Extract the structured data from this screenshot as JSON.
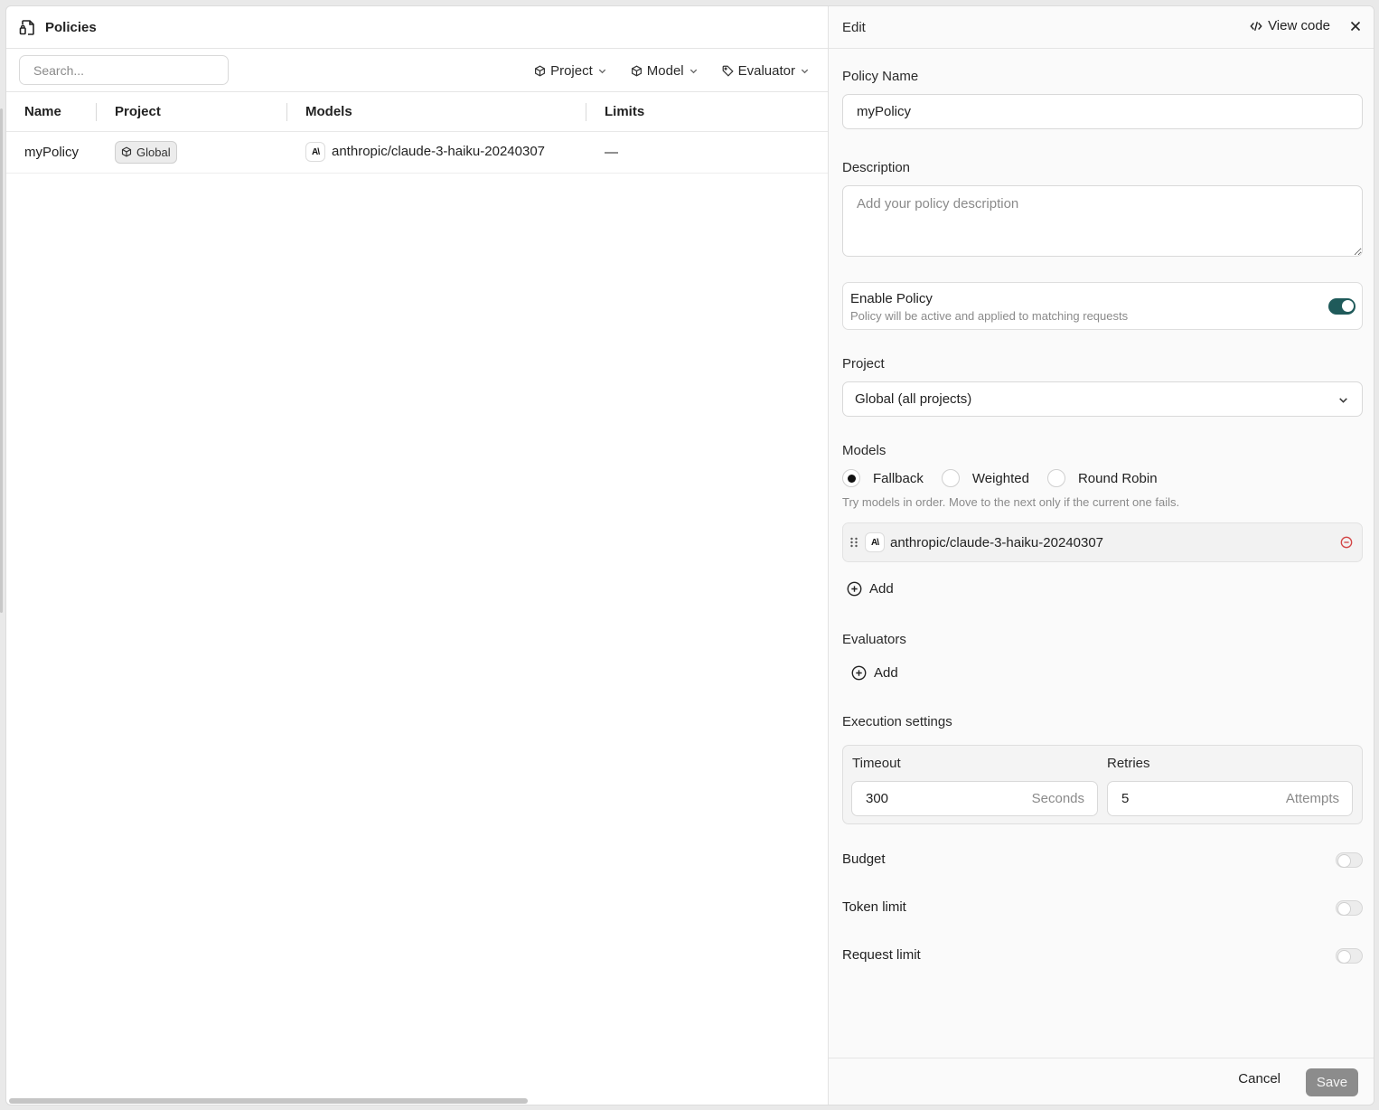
{
  "page": {
    "title": "Policies"
  },
  "toolbar": {
    "search_placeholder": "Search...",
    "filters": [
      "Project",
      "Model",
      "Evaluator"
    ]
  },
  "table": {
    "columns": [
      "Name",
      "Project",
      "Models",
      "Limits"
    ],
    "rows": [
      {
        "name": "myPolicy",
        "project": "Global",
        "model": "anthropic/claude-3-haiku-20240307",
        "model_logo": "A\\",
        "limits": "—"
      }
    ]
  },
  "panel": {
    "title": "Edit",
    "view_code": "View code",
    "policy_name": {
      "label": "Policy Name",
      "value": "myPolicy"
    },
    "description": {
      "label": "Description",
      "placeholder": "Add your policy description"
    },
    "enable": {
      "title": "Enable Policy",
      "subtitle": "Policy will be active and applied to matching requests",
      "enabled": true
    },
    "project": {
      "label": "Project",
      "value": "Global (all projects)"
    },
    "models": {
      "label": "Models",
      "strategies": [
        "Fallback",
        "Weighted",
        "Round Robin"
      ],
      "selected": "Fallback",
      "hint": "Try models in order. Move to the next only if the current one fails.",
      "items": [
        {
          "name": "anthropic/claude-3-haiku-20240307",
          "logo": "A\\"
        }
      ],
      "add_label": "Add"
    },
    "evaluators": {
      "label": "Evaluators",
      "add_label": "Add"
    },
    "execution": {
      "label": "Execution settings",
      "timeout_label": "Timeout",
      "timeout_value": "300",
      "timeout_unit": "Seconds",
      "retries_label": "Retries",
      "retries_value": "5",
      "retries_unit": "Attempts"
    },
    "toggles": [
      {
        "label": "Budget",
        "enabled": false
      },
      {
        "label": "Token limit",
        "enabled": false
      },
      {
        "label": "Request limit",
        "enabled": false
      }
    ],
    "cancel_label": "Cancel",
    "save_label": "Save"
  },
  "colors": {
    "toggle_on": "#1f5a5a",
    "save_disabled": "#8c8c8c",
    "remove_icon": "#d34545"
  }
}
